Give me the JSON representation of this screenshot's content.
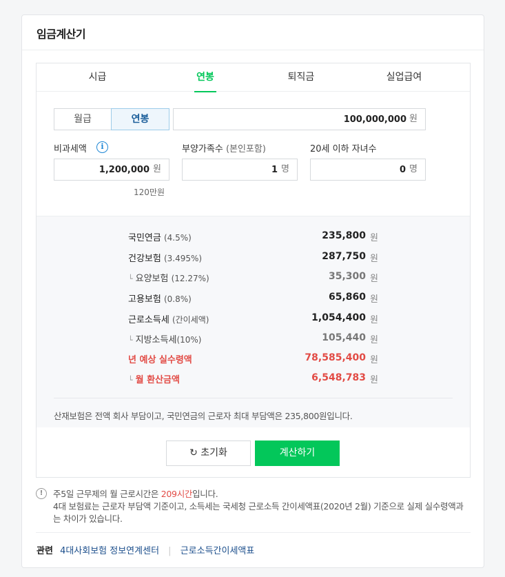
{
  "title": "임금계산기",
  "tabs": [
    "시급",
    "연봉",
    "퇴직금",
    "실업급여"
  ],
  "active_tab": "연봉",
  "pay_type": {
    "monthly": "월급",
    "annual": "연봉",
    "selected": "연봉"
  },
  "salary": {
    "value": "100,000,000",
    "unit": "원"
  },
  "nontax": {
    "label": "비과세액",
    "value": "1,200,000",
    "unit": "원",
    "hint": "120만원",
    "info_icon": "i"
  },
  "dependents": {
    "label": "부양가족수",
    "sub": "(본인포함)",
    "value": "1",
    "unit": "명"
  },
  "children": {
    "label": "20세 이하 자녀수",
    "value": "0",
    "unit": "명"
  },
  "results": [
    {
      "name": "국민연금",
      "rate": "(4.5%)",
      "value": "235,800",
      "unit": "원",
      "kind": "main"
    },
    {
      "name": "건강보험",
      "rate": "(3.495%)",
      "value": "287,750",
      "unit": "원",
      "kind": "main"
    },
    {
      "name": "요양보험",
      "rate": "(12.27%)",
      "value": "35,300",
      "unit": "원",
      "kind": "sub"
    },
    {
      "name": "고용보험",
      "rate": "(0.8%)",
      "value": "65,860",
      "unit": "원",
      "kind": "main"
    },
    {
      "name": "근로소득세",
      "rate": "(간이세액)",
      "value": "1,054,400",
      "unit": "원",
      "kind": "main"
    },
    {
      "name": "지방소득세",
      "rate": "(10%)",
      "value": "105,440",
      "unit": "원",
      "kind": "sub"
    },
    {
      "name": "년 예상 실수령액",
      "rate": "",
      "value": "78,585,400",
      "unit": "원",
      "kind": "red"
    },
    {
      "name": "월 환산금액",
      "rate": "",
      "value": "6,548,783",
      "unit": "원",
      "kind": "red-sub"
    }
  ],
  "notice": "산재보험은 전액 회사 부담이고, 국민연금의 근로자 최대 부담액은 235,800원입니다.",
  "buttons": {
    "reset": "초기화",
    "reset_icon": "↻",
    "calculate": "계산하기"
  },
  "footnote": {
    "icon": "!",
    "line1_prefix": "주5일 근무제의 월 근로시간은 ",
    "line1_hours": "209시간",
    "line1_suffix": "입니다.",
    "line2": "4대 보험료는 근로자 부담액 기준이고, 소득세는 국세청 근로소득 간이세액표(2020년 2월) 기준으로 실제 실수령액과는 차이가 있습니다."
  },
  "related": {
    "label": "관련",
    "links": [
      "4대사회보험 정보연계센터",
      "근로소득간이세액표"
    ]
  },
  "colors": {
    "accent": "#03c75a",
    "red": "#e24b45",
    "link": "#1c4f8c",
    "info": "#1e87d5"
  }
}
